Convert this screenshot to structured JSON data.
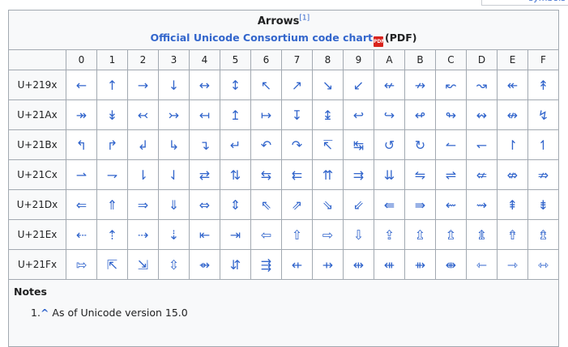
{
  "top_fragment": "symbols",
  "title": "Arrows",
  "title_ref": "[1]",
  "chart_link": "Official Unicode Consortium code chart",
  "pdf_icon_label": "PDF",
  "pdf_text": "(PDF)",
  "columns": [
    "0",
    "1",
    "2",
    "3",
    "4",
    "5",
    "6",
    "7",
    "8",
    "9",
    "A",
    "B",
    "C",
    "D",
    "E",
    "F"
  ],
  "rows": [
    {
      "label": "U+219x",
      "chars": [
        "←",
        "↑",
        "→",
        "↓",
        "↔",
        "↕",
        "↖",
        "↗",
        "↘",
        "↙",
        "↚",
        "↛",
        "↜",
        "↝",
        "↞",
        "↟"
      ]
    },
    {
      "label": "U+21Ax",
      "chars": [
        "↠",
        "↡",
        "↢",
        "↣",
        "↤",
        "↥",
        "↦",
        "↧",
        "↨",
        "↩",
        "↪",
        "↫",
        "↬",
        "↭",
        "↮",
        "↯"
      ]
    },
    {
      "label": "U+21Bx",
      "chars": [
        "↰",
        "↱",
        "↲",
        "↳",
        "↴",
        "↵",
        "↶",
        "↷",
        "↸",
        "↹",
        "↺",
        "↻",
        "↼",
        "↽",
        "↾",
        "↿"
      ]
    },
    {
      "label": "U+21Cx",
      "chars": [
        "⇀",
        "⇁",
        "⇂",
        "⇃",
        "⇄",
        "⇅",
        "⇆",
        "⇇",
        "⇈",
        "⇉",
        "⇊",
        "⇋",
        "⇌",
        "⇍",
        "⇎",
        "⇏"
      ]
    },
    {
      "label": "U+21Dx",
      "chars": [
        "⇐",
        "⇑",
        "⇒",
        "⇓",
        "⇔",
        "⇕",
        "⇖",
        "⇗",
        "⇘",
        "⇙",
        "⇚",
        "⇛",
        "⇜",
        "⇝",
        "⇞",
        "⇟"
      ]
    },
    {
      "label": "U+21Ex",
      "chars": [
        "⇠",
        "⇡",
        "⇢",
        "⇣",
        "⇤",
        "⇥",
        "⇦",
        "⇧",
        "⇨",
        "⇩",
        "⇪",
        "⇫",
        "⇬",
        "⇭",
        "⇮",
        "⇯"
      ]
    },
    {
      "label": "U+21Fx",
      "chars": [
        "⇰",
        "⇱",
        "⇲",
        "⇳",
        "⇴",
        "⇵",
        "⇶",
        "⇷",
        "⇸",
        "⇹",
        "⇺",
        "⇻",
        "⇼",
        "⇽",
        "⇾",
        "⇿"
      ]
    }
  ],
  "notes": {
    "heading": "Notes",
    "items": [
      {
        "number": "1.",
        "caret": "^",
        "text": "As of Unicode version 15.0"
      }
    ]
  }
}
